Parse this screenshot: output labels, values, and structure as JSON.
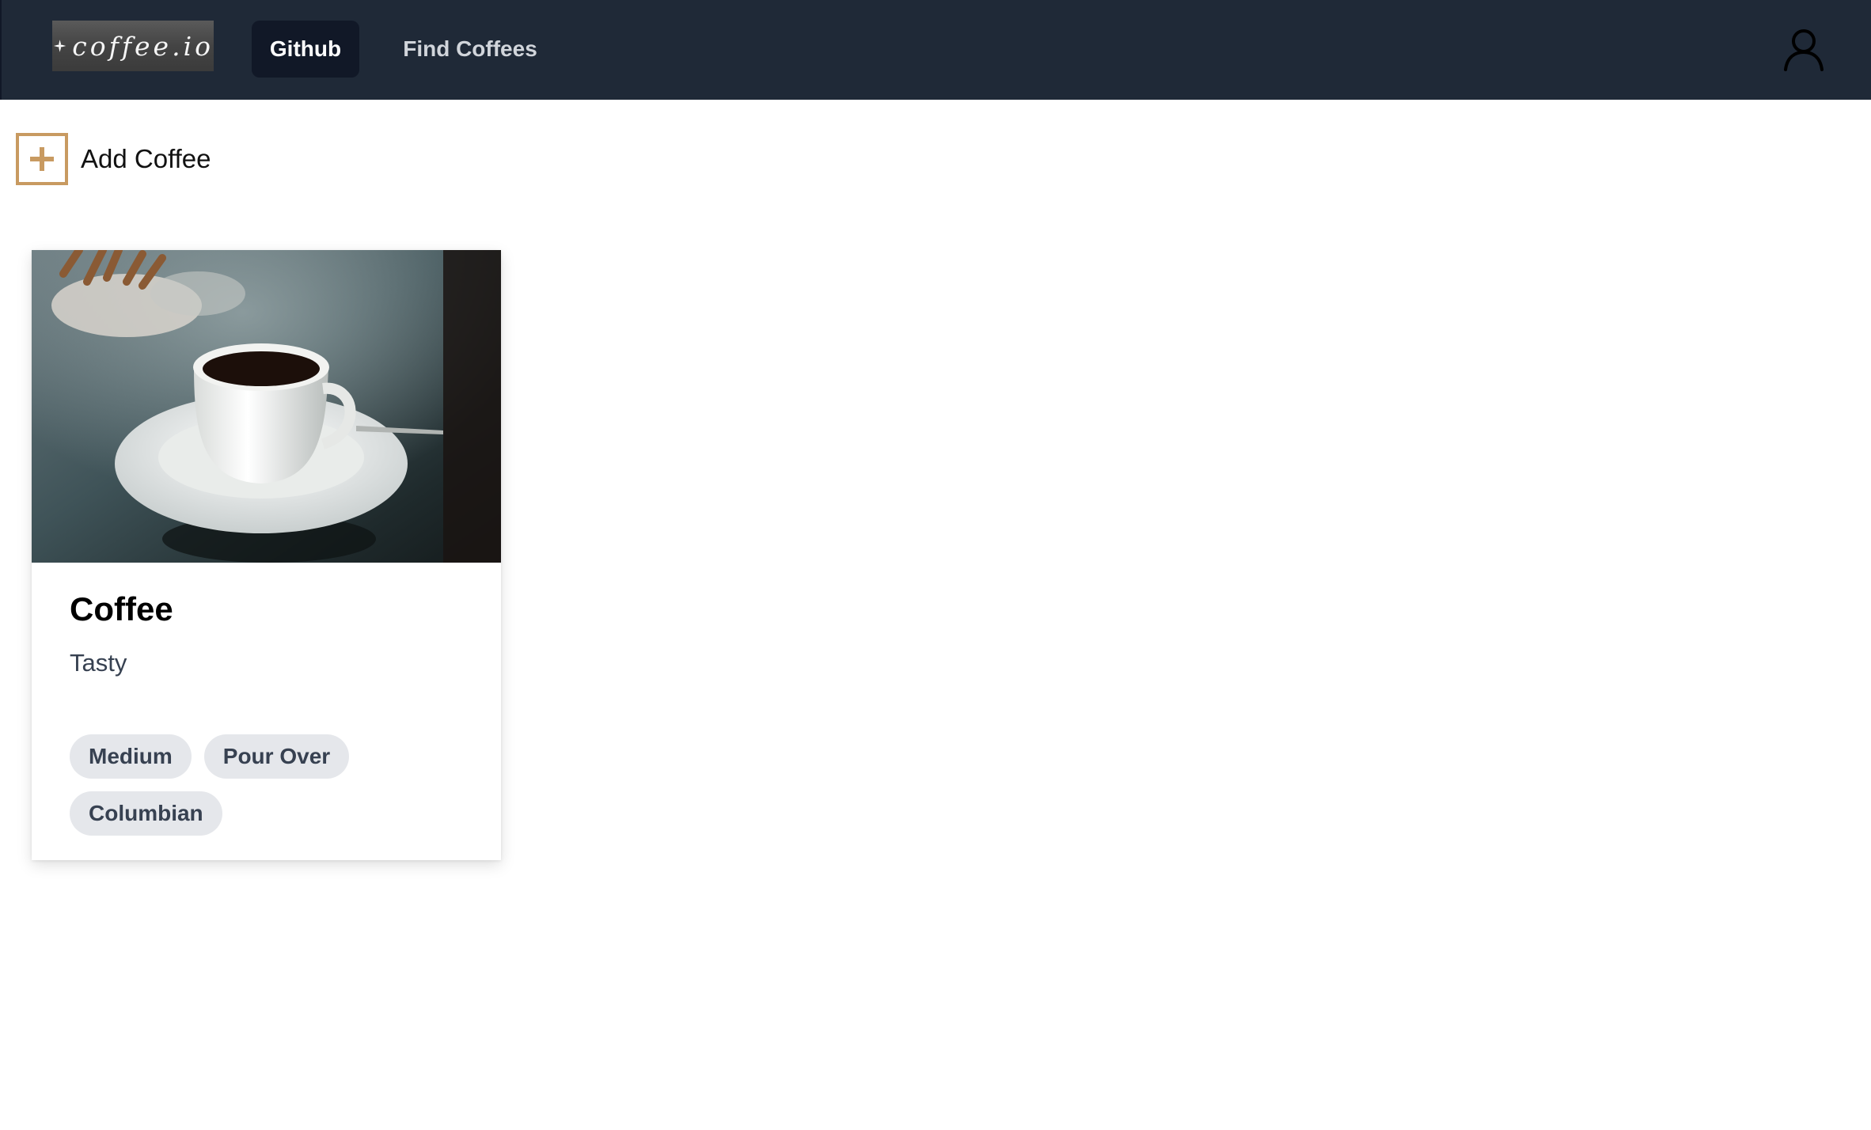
{
  "header": {
    "logo_text": "coffee.io",
    "nav": {
      "github_label": "Github",
      "find_label": "Find Coffees"
    },
    "user_icon": "user-icon"
  },
  "actions": {
    "add_label": "Add Coffee",
    "add_icon": "plus-icon",
    "accent_color": "#c89a61"
  },
  "coffees": [
    {
      "name": "Coffee",
      "description": "Tasty",
      "image": "coffee-cup-photo",
      "tags": [
        "Medium",
        "Pour Over",
        "Columbian"
      ]
    }
  ],
  "colors": {
    "topbar": "#1f2937",
    "active_nav": "#111827",
    "tag_bg": "#e5e7eb"
  }
}
